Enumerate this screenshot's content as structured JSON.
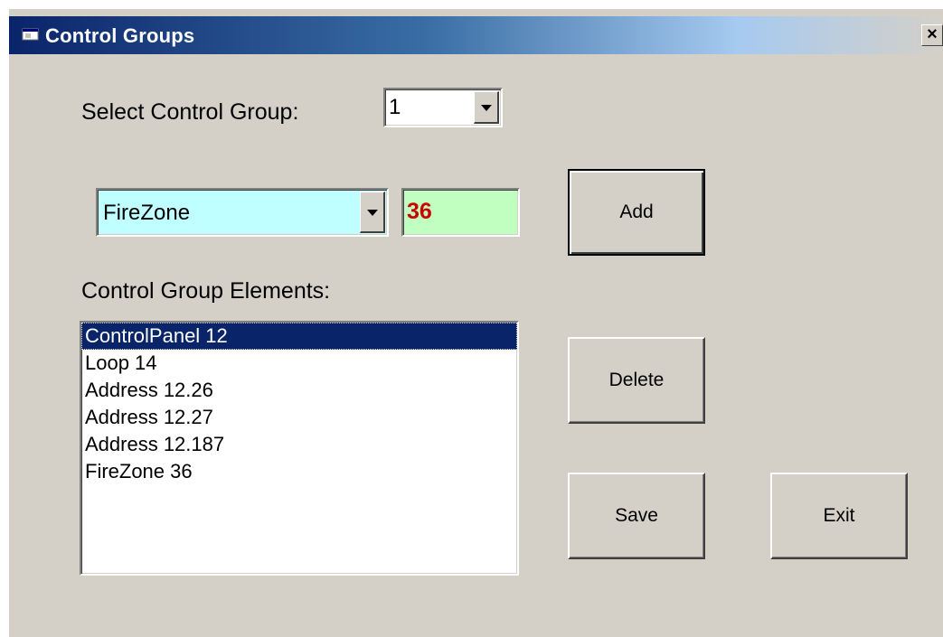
{
  "window": {
    "title": "Control Groups",
    "close_label": "×"
  },
  "select_group": {
    "label": "Select Control Group:",
    "value": "1"
  },
  "element_type": {
    "value": "FireZone",
    "background": "#c0ffff"
  },
  "element_number": {
    "value": "36",
    "color": "#cc0000",
    "background": "#c0ffc0"
  },
  "buttons": {
    "add": "Add",
    "delete": "Delete",
    "save": "Save",
    "exit": "Exit"
  },
  "elements": {
    "label": "Control Group Elements:",
    "items": [
      "ControlPanel 12",
      "Loop 14",
      "Address 12.26",
      "Address 12.27",
      "Address 12.187",
      "FireZone 36"
    ],
    "selected_index": 0
  },
  "colors": {
    "face": "#d4d0c8",
    "title_active": "#0a246a",
    "selection": "#0a246a"
  }
}
